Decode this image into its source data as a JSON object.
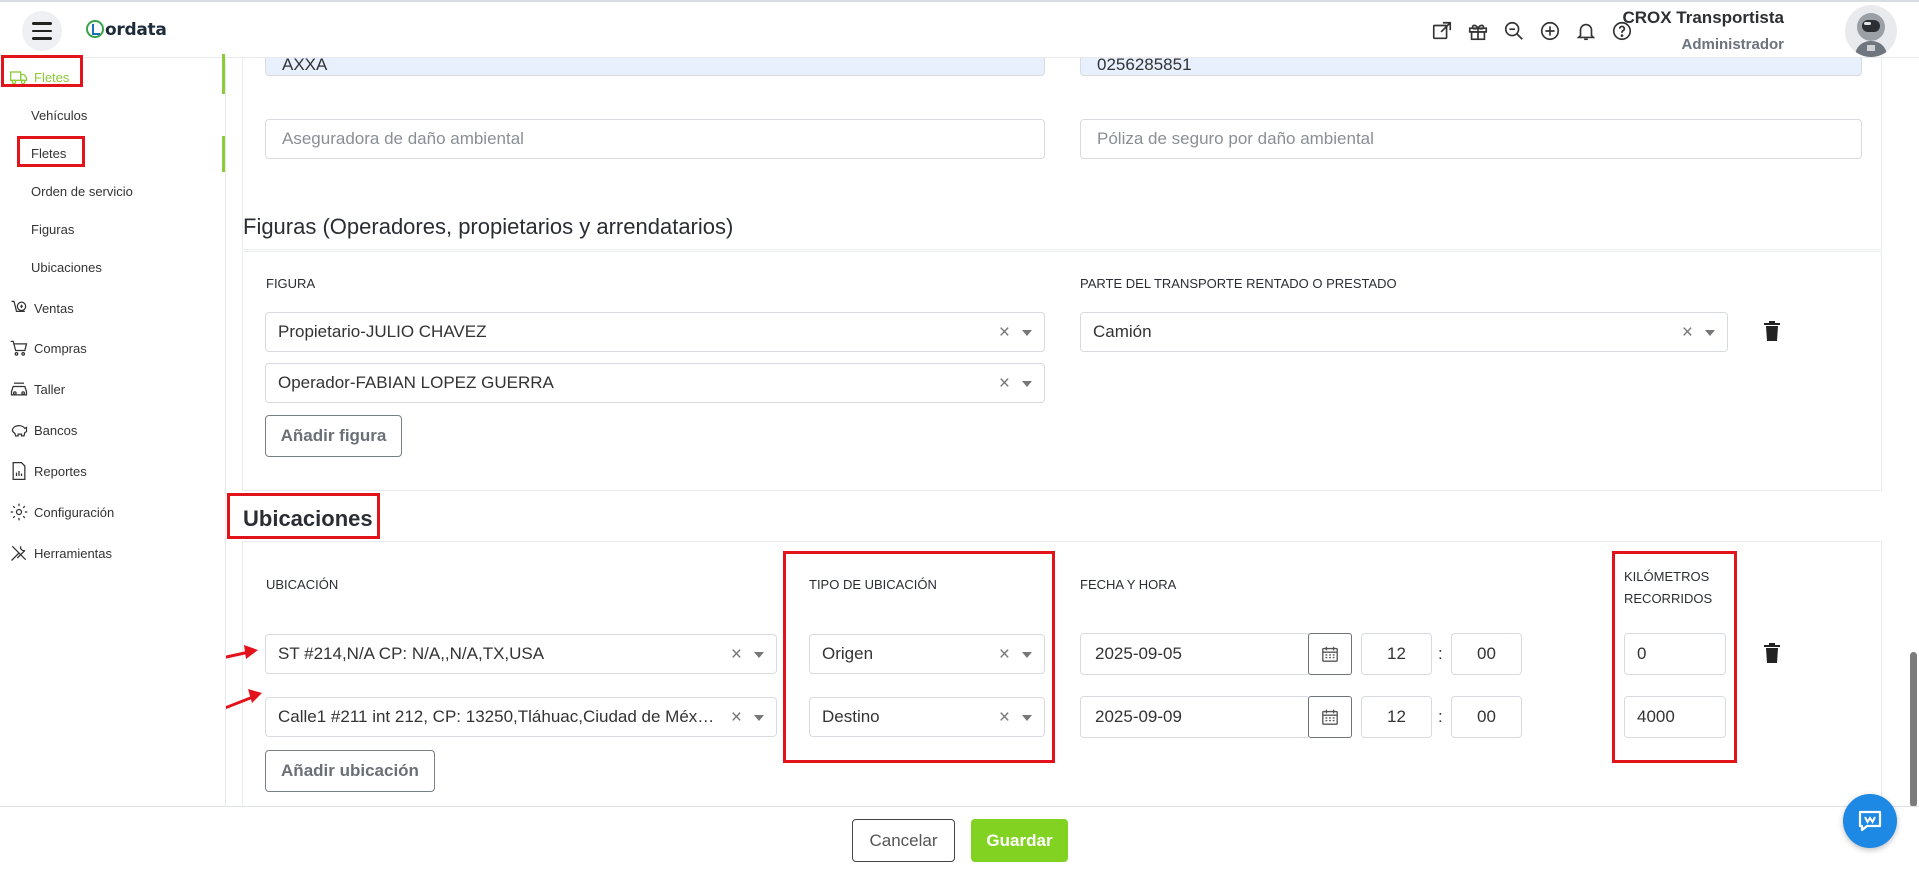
{
  "header": {
    "logo_text": "ordata",
    "user_name": "CROX Transportista",
    "user_role": "Administrador",
    "icons": [
      "external-link-icon",
      "gift-icon",
      "search-zoom-icon",
      "plus-circle-icon",
      "bell-icon",
      "help-icon"
    ]
  },
  "sidebar": {
    "main_active": "Fletes",
    "subitems": [
      "Vehículos",
      "Fletes",
      "Orden de servicio",
      "Figuras",
      "Ubicaciones"
    ],
    "items": [
      "Ventas",
      "Compras",
      "Taller",
      "Bancos",
      "Reportes",
      "Configuración",
      "Herramientas"
    ]
  },
  "insurance": {
    "insurer_value": "AXXA",
    "policy_value": "0256285851",
    "env_insurer_placeholder": "Aseguradora de daño ambiental",
    "env_policy_placeholder": "Póliza de seguro por daño ambiental"
  },
  "figuras": {
    "title": "Figuras (Operadores, propietarios y arrendatarios)",
    "col_figura": "FIGURA",
    "col_parte": "PARTE DEL TRANSPORTE RENTADO O PRESTADO",
    "figura_1": "Propietario-JULIO CHAVEZ",
    "figura_2": "Operador-FABIAN LOPEZ GUERRA",
    "parte_1": "Camión",
    "add_label": "Añadir figura"
  },
  "ubicaciones": {
    "title": "Ubicaciones",
    "col_ubicacion": "UBICACIÓN",
    "col_tipo": "TIPO DE UBICACIÓN",
    "col_fecha": "FECHA Y HORA",
    "col_km_1": "KILÓMETROS",
    "col_km_2": "RECORRIDOS",
    "rows": [
      {
        "ubicacion": "ST #214,N/A CP: N/A,,N/A,TX,USA",
        "tipo": "Origen",
        "fecha": "2025-09-05",
        "hora": "12",
        "minuto": "00",
        "km": "0"
      },
      {
        "ubicacion": "Calle1 #211 int 212, CP: 13250,Tláhuac,Ciudad de Méx…",
        "tipo": "Destino",
        "fecha": "2025-09-09",
        "hora": "12",
        "minuto": "00",
        "km": "4000"
      }
    ],
    "colon": ":",
    "add_label": "Añadir ubicación"
  },
  "footer": {
    "cancel_label": "Cancelar",
    "save_label": "Guardar"
  },
  "colors": {
    "accent_green": "#82d321",
    "annotation_red": "#e3131b",
    "chat_blue": "#1e88e5"
  }
}
